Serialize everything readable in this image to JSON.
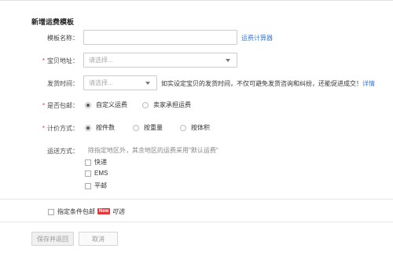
{
  "section_title": "新增运费模板",
  "template_name": {
    "label": "模板名称：",
    "value": "",
    "link": "运费计算器"
  },
  "location": {
    "label": "宝贝地址：",
    "placeholder": "请选择..."
  },
  "ship_time": {
    "label": "发货时间：",
    "placeholder": "请选择...",
    "hint": "如实设定宝贝的发货时间，不仅可避免发货咨询和纠纷，还能促进成交！",
    "link": "详情"
  },
  "free_shipping": {
    "label": "是否包邮：",
    "options": [
      "自定义运费",
      "卖家承担运费"
    ],
    "selected": 0
  },
  "pricing": {
    "label": "计价方式：",
    "options": [
      "按件数",
      "按重量",
      "按体积"
    ],
    "selected": 0
  },
  "delivery": {
    "label": "运送方式：",
    "note": "除指定地区外，其余地区的运费采用\"默认运费\"",
    "methods": [
      "快递",
      "EMS",
      "平邮"
    ]
  },
  "conditional_free": {
    "label": "指定条件包邮",
    "badge": "New",
    "suffix": "可选"
  },
  "buttons": {
    "save": "保存并返回",
    "cancel": "取消"
  }
}
